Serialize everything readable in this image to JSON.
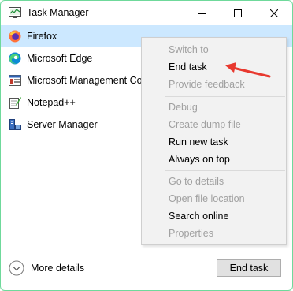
{
  "window": {
    "title": "Task Manager",
    "controls": {
      "minimize_icon": "minimize-icon",
      "maximize_icon": "maximize-icon",
      "close_icon": "close-icon"
    }
  },
  "processes": [
    {
      "label": "Firefox",
      "icon": "firefox-icon",
      "selected": true
    },
    {
      "label": "Microsoft Edge",
      "icon": "edge-icon"
    },
    {
      "label": "Microsoft Management Console",
      "icon": "mmc-icon"
    },
    {
      "label": "Notepad++",
      "icon": "notepadpp-icon"
    },
    {
      "label": "Server Manager",
      "icon": "server-manager-icon"
    }
  ],
  "context_menu": {
    "groups": [
      [
        {
          "label": "Switch to",
          "enabled": false
        },
        {
          "label": "End task",
          "enabled": true
        },
        {
          "label": "Provide feedback",
          "enabled": false
        }
      ],
      [
        {
          "label": "Debug",
          "enabled": false
        },
        {
          "label": "Create dump file",
          "enabled": false
        },
        {
          "label": "Run new task",
          "enabled": true
        },
        {
          "label": "Always on top",
          "enabled": true
        }
      ],
      [
        {
          "label": "Go to details",
          "enabled": false
        },
        {
          "label": "Open file location",
          "enabled": false
        },
        {
          "label": "Search online",
          "enabled": true
        },
        {
          "label": "Properties",
          "enabled": false
        }
      ]
    ]
  },
  "footer": {
    "more_details": "More details",
    "end_task_button": "End task"
  },
  "annotation": {
    "arrow_color": "#e8392f",
    "points_to": "End task"
  },
  "colors": {
    "selection": "#cce8ff",
    "window_border": "#6fd99b",
    "menu_bg": "#f2f2f2",
    "disabled_text": "#a0a0a0"
  }
}
